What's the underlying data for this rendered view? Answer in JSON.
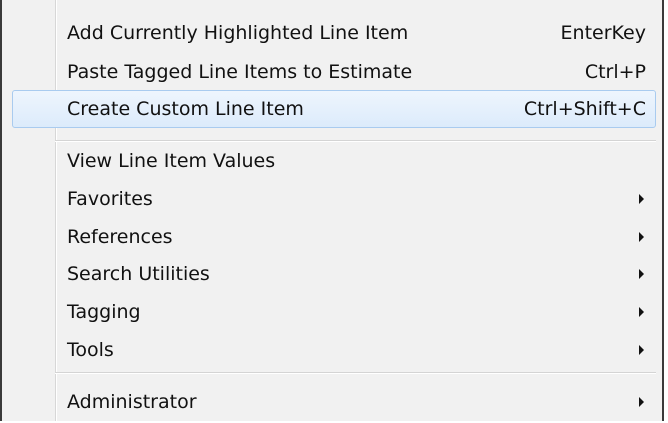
{
  "menu": {
    "items": [
      {
        "label": "Add Currently Highlighted Line Item",
        "shortcut": "EnterKey"
      },
      {
        "label": "Paste Tagged Line Items to Estimate",
        "shortcut": "Ctrl+P"
      },
      {
        "label": "Create Custom Line Item",
        "shortcut": "Ctrl+Shift+C"
      },
      {
        "label": "View Line Item Values"
      },
      {
        "label": "Favorites"
      },
      {
        "label": "References"
      },
      {
        "label": "Search Utilities"
      },
      {
        "label": "Tagging"
      },
      {
        "label": "Tools"
      },
      {
        "label": "Administrator"
      }
    ],
    "highlighted_item": "Create Custom Line Item",
    "colors": {
      "background": "#f1f1f1",
      "highlight_fill": "#dcebfb",
      "highlight_border": "#a9cbef",
      "border": "#3a3a3a"
    },
    "icons": {
      "submenu": "submenu-arrow-icon"
    }
  }
}
